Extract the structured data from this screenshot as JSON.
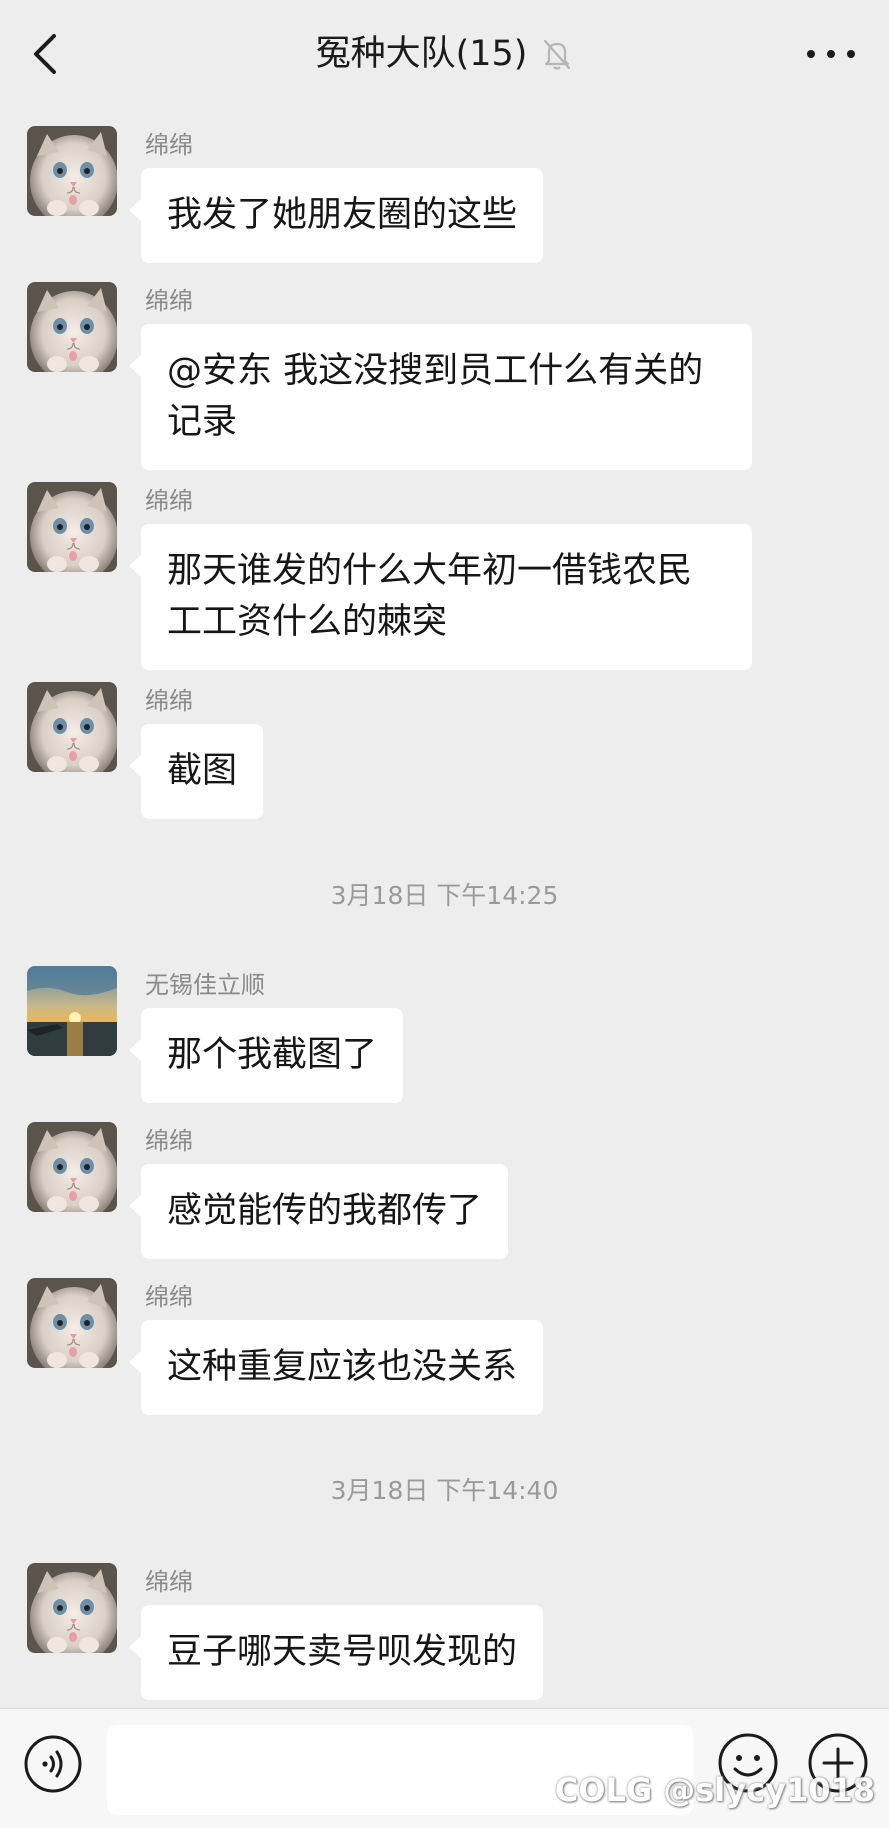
{
  "header": {
    "title": "冤种大队(15)",
    "back_icon": "chevron-left-icon",
    "mute_icon": "bell-slash-icon",
    "more_icon": "more-dots-icon"
  },
  "messages": [
    {
      "sender": "绵绵",
      "text": "我发了她朋友圈的这些",
      "avatar": "cat-avatar"
    },
    {
      "sender": "绵绵",
      "text": "@安东  我这没搜到员工什么有关的记录",
      "avatar": "cat-avatar"
    },
    {
      "sender": "绵绵",
      "text": "那天谁发的什么大年初一借钱农民工工资什么的棘突",
      "avatar": "cat-avatar"
    },
    {
      "sender": "绵绵",
      "text": "截图",
      "avatar": "cat-avatar"
    },
    {
      "sender": "无锡佳立顺",
      "text": "那个我截图了",
      "avatar": "sunset-avatar"
    },
    {
      "sender": "绵绵",
      "text": "感觉能传的我都传了",
      "avatar": "cat-avatar"
    },
    {
      "sender": "绵绵",
      "text": "这种重复应该也没关系",
      "avatar": "cat-avatar"
    },
    {
      "sender": "绵绵",
      "text": "豆子哪天卖号呗发现的",
      "avatar": "cat-avatar"
    }
  ],
  "timestamps": [
    "3月18日 下午14:25",
    "3月18日 下午14:40"
  ],
  "input_bar": {
    "text_value": "",
    "voice_icon": "voice-icon",
    "emoji_icon": "emoji-icon",
    "plus_icon": "plus-icon"
  },
  "watermark": "COLG @slycy1018",
  "colors": {
    "background": "#ededed",
    "bubble": "#ffffff",
    "meta_text": "#8a8a8a"
  }
}
